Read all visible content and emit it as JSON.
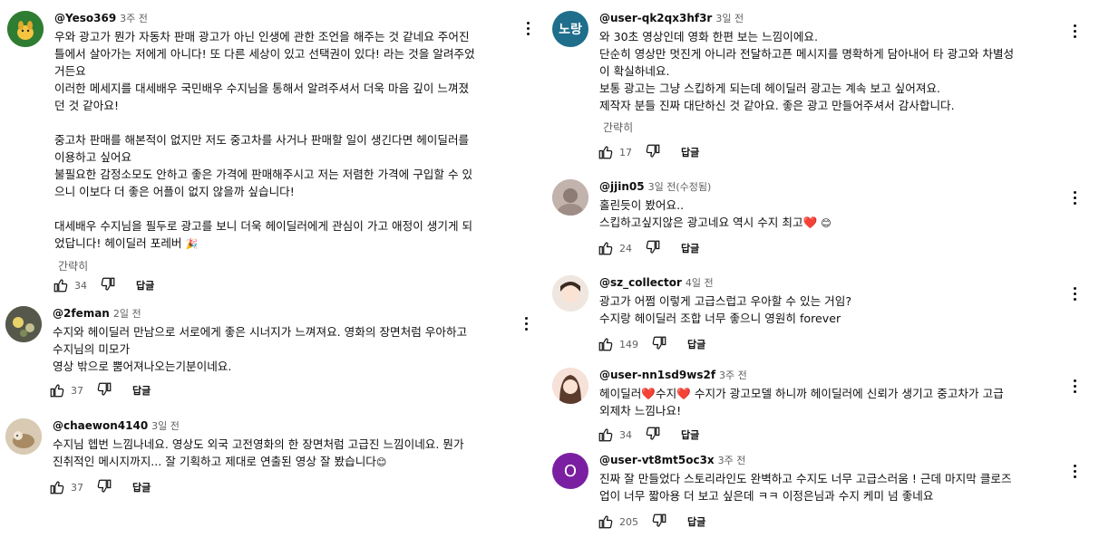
{
  "left": [
    {
      "author": "@Yeso369",
      "time": "3주 전",
      "text": "우와 광고가 뭔가 자동차 판매 광고가 아닌 인생에 관한 조언을 해주는 것 같네요 주어진\n틀에서 살아가는 저에게 아니다! 또 다른 세상이 있고 선택권이 있다! 라는 것을 알려주었\n거든요\n이러한 메세지를 대세배우 국민배우 수지님을 통해서 알려주셔서 더욱 마음 깊이 느껴졌\n던 것 같아요!\n\n중고차 판매를 해본적이 없지만 저도 중고차를 사거나 판매할 일이 생긴다면 헤이딜러를\n이용하고 싶어요\n불필요한 감정소모도 안하고 좋은 가격에 판매해주시고 저는 저렴한 가격에 구입할 수 있\n으니 이보다 더 좋은 어플이 없지 않을까 싶습니다!\n\n대세배우 수지님을 필두로 광고를 보니 더욱 헤이딜러에게 관심이 가고 애정이 생기게 되\n었답니다! 헤이딜러 포레버",
      "emoji": "🎉",
      "brief": "간략히",
      "likes": "34",
      "reply": "답글",
      "avatar_color": "#2e7d32"
    },
    {
      "author": "@2feman",
      "time": "2일 전",
      "text": "수지와 헤이딜러 만남으로 서로에게 좋은 시너지가 느껴져요. 영화의 장면처럼 우아하고\n수지님의 미모가\n영상 밖으로 뿜어져나오는기분이네요.",
      "likes": "37",
      "reply": "답글",
      "avatar_color": "#6d6d5a"
    },
    {
      "author": "@chaewon4140",
      "time": "3일 전",
      "text": "수지님 헵번 느낌나네요. 영상도 외국 고전영화의 한 장면처럼 고급진 느낌이네요. 뭔가\n진취적인 메시지까지... 잘 기획하고 제대로 연출된 영상 잘 봤습니다",
      "emoji": "😊",
      "likes": "37",
      "reply": "답글",
      "avatar_color": "#c9b79c"
    }
  ],
  "right": [
    {
      "author": "@user-qk2qx3hf3r",
      "time": "3일 전",
      "avatar_initial": "노랑",
      "text": "와 30초 영상인데 영화 한편 보는 느낌이에요.\n단순히 영상만 멋진게 아니라 전달하고픈 메시지를 명확하게 담아내어 타 광고와 차별성\n이 확실하네요.\n보통 광고는 그냥 스킵하게 되는데 헤이딜러 광고는 계속 보고 싶어져요.\n제작자 분들 진짜 대단하신 것 같아요. 좋은 광고 만들어주셔서 감사합니다.",
      "brief": "간략히",
      "likes": "17",
      "reply": "답글",
      "avatar_color": "#1e6e8c"
    },
    {
      "author": "@jjin05",
      "time": "3일 전(수정됨)",
      "text": "홀린듯이 봤어요..\n스킵하고싶지않은 광고네요 역시 수지 최고",
      "heart": "❤️",
      "emoji": "😊",
      "likes": "24",
      "reply": "답글",
      "avatar_color": "#b9a9a3"
    },
    {
      "author": "@sz_collector",
      "time": "4일 전",
      "text": "광고가 어쩜 이렇게 고급스럽고 우아할 수 있는 거임?\n수지랑 헤이딜러 조합 너무 좋으니 영원히 forever",
      "likes": "149",
      "reply": "답글",
      "avatar_color": "#e8e0d8"
    },
    {
      "author": "@user-nn1sd9ws2f",
      "time": "3주 전",
      "text_parts": [
        "헤이딜러",
        "수지",
        " 수지가 광고모델 하니까 헤이딜러에 신뢰가 생기고 중고차가 고급\n외제차 느낌나요!"
      ],
      "heart": "❤️",
      "likes": "34",
      "reply": "답글",
      "avatar_color": "#f2d4c8"
    },
    {
      "author": "@user-vt8mt5oc3x",
      "time": "3주 전",
      "avatar_initial": "O",
      "text": "진짜 잘 만들었다 스토리라인도 완벽하고 수지도 너무 고급스러움 ! 근데 마지막 클로즈\n업이 너무 짧아용 더 보고 싶은데 ㅋㅋ 이정은님과 수지 케미 넘 좋네요",
      "likes": "205",
      "reply": "답글",
      "avatar_color": "#7b1fa2"
    }
  ]
}
